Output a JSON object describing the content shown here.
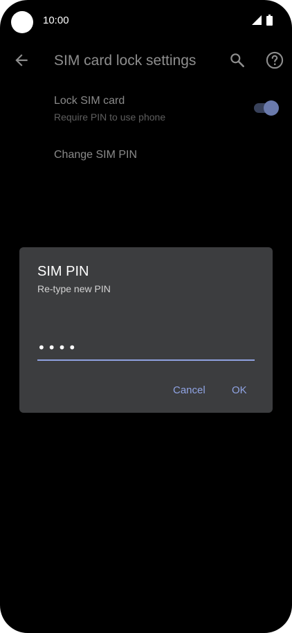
{
  "status_bar": {
    "time": "10:00",
    "icons": [
      "signal-icon",
      "battery-icon"
    ]
  },
  "app_bar": {
    "title": "SIM card lock settings",
    "icons": [
      "back-arrow-icon",
      "search-icon",
      "help-icon"
    ]
  },
  "settings": {
    "lock_sim": {
      "title": "Lock SIM card",
      "summary": "Require PIN to use phone",
      "enabled": true
    },
    "change_pin": {
      "title": "Change SIM PIN"
    }
  },
  "dialog": {
    "title": "SIM PIN",
    "message": "Re-type new PIN",
    "input_value": "1234",
    "cancel_label": "Cancel",
    "ok_label": "OK"
  },
  "colors": {
    "background": "#000000",
    "dialog_background": "#3c3d3f",
    "accent": "#90a4e4"
  }
}
